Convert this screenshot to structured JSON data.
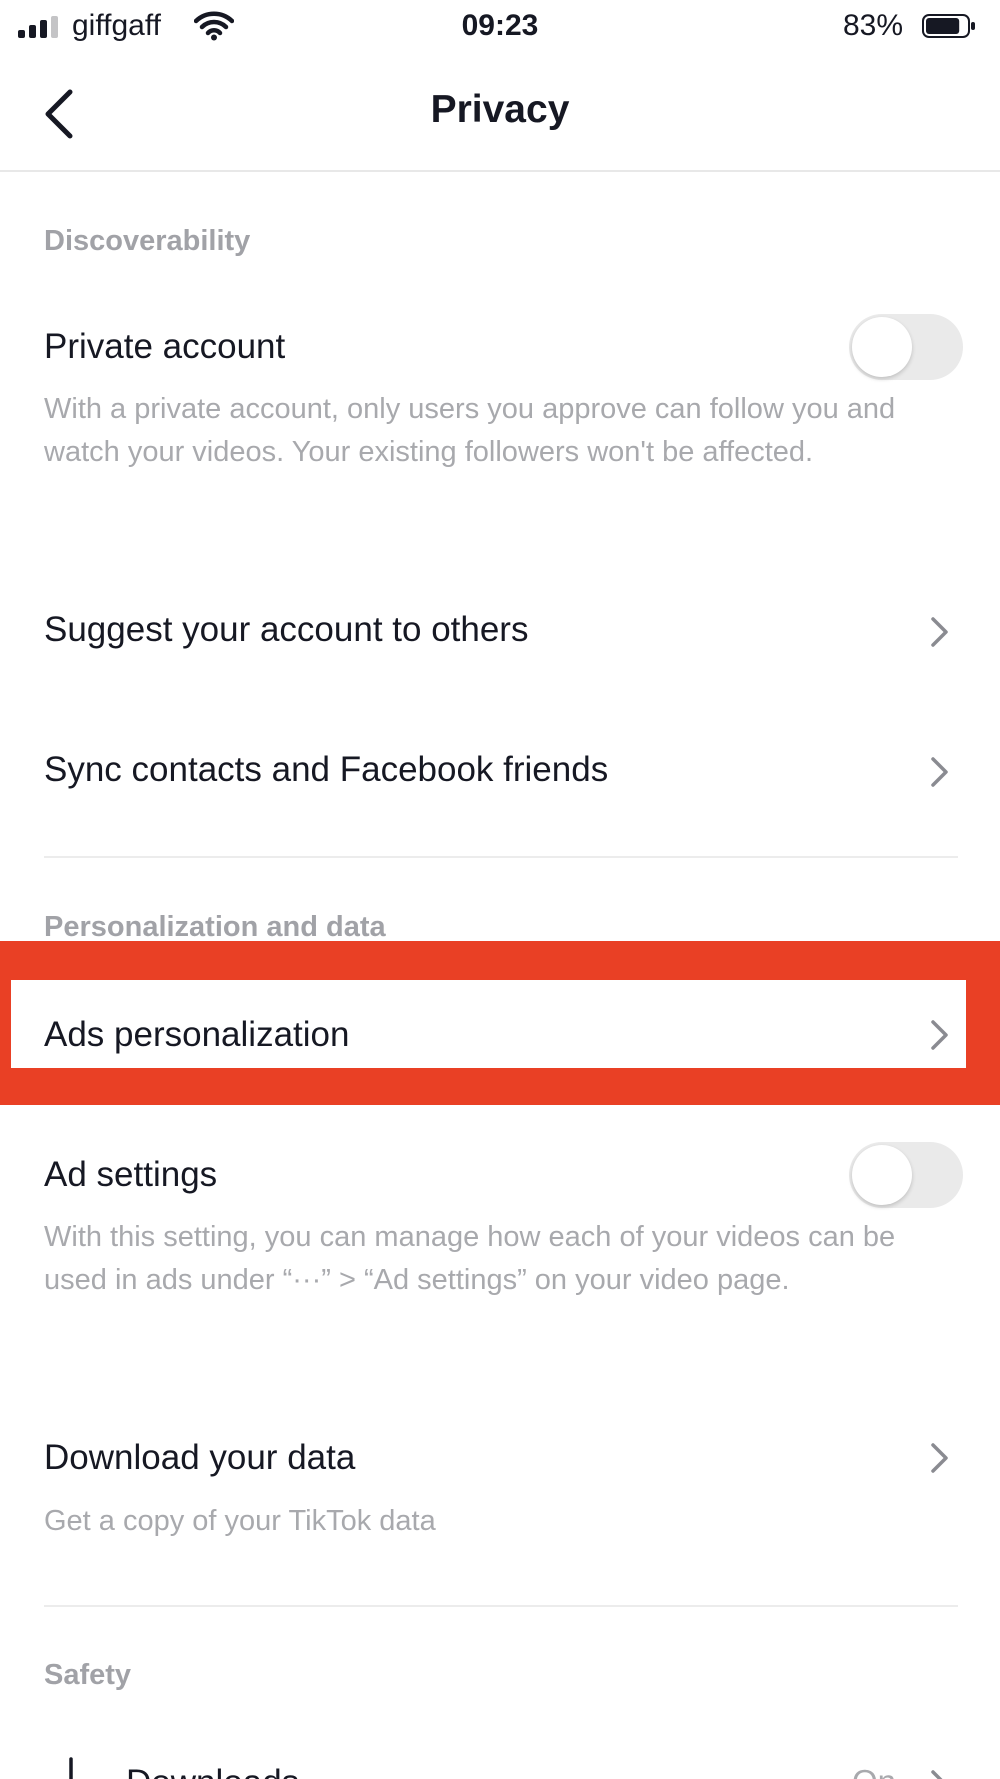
{
  "status_bar": {
    "carrier": "giffgaff",
    "time": "09:23",
    "battery_percent": "83%",
    "battery_level": 0.83,
    "signal_bars": 3
  },
  "header": {
    "title": "Privacy",
    "back_icon": "chevron-left-icon"
  },
  "sections": {
    "discoverability": {
      "title": "Discoverability",
      "private_account": {
        "label": "Private account",
        "description": "With a private account, only users you approve can follow you and watch your videos. Your existing followers won't be affected.",
        "enabled": false
      },
      "suggest_account": {
        "label": "Suggest your account to others"
      },
      "sync_contacts": {
        "label": "Sync contacts and Facebook friends"
      }
    },
    "personalization": {
      "title": "Personalization and data",
      "ads_personalization": {
        "label": "Ads personalization"
      },
      "ad_settings": {
        "label": "Ad settings",
        "description": "With this setting, you can manage how each of your videos can be used in ads under “···” > “Ad settings” on your video page.",
        "enabled": false
      },
      "download_data": {
        "label": "Download your data",
        "description": "Get a copy of your TikTok data"
      }
    },
    "safety": {
      "title": "Safety",
      "downloads": {
        "label": "Downloads",
        "value": "On"
      }
    }
  },
  "colors": {
    "highlight": "#e94025",
    "text": "#161823",
    "secondary_text": "#a8a9ad",
    "toggle_off": "#eaeaea"
  }
}
